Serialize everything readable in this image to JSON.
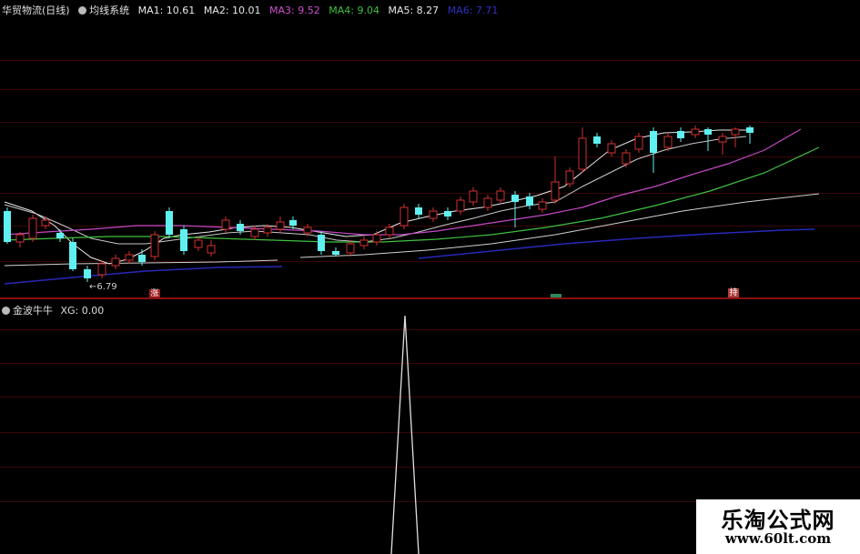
{
  "header": {
    "stock_name": "华贸物流(日线)",
    "indicator": "均线系统",
    "ma": [
      {
        "label": "MA1: 10.61",
        "color": "#e8e8e8"
      },
      {
        "label": "MA2: 10.01",
        "color": "#e8e8e8"
      },
      {
        "label": "MA3: 9.52",
        "color": "#d04cd0"
      },
      {
        "label": "MA4: 9.04",
        "color": "#40c040"
      },
      {
        "label": "MA5: 8.27",
        "color": "#e8e8e8"
      },
      {
        "label": "MA6: 7.71",
        "color": "#3030c0"
      }
    ]
  },
  "main_chart": {
    "low_label": "6.79",
    "markers": [
      {
        "text": "涨",
        "color": "#a02020"
      },
      {
        "text": "",
        "color": "#2a8a5a"
      },
      {
        "text": "持",
        "color": "#b04040"
      }
    ],
    "colors": {
      "up": "#d03030",
      "down": "#60f0f0",
      "grid": "#3a0606"
    }
  },
  "sub_chart": {
    "name": "金波牛牛",
    "value_label": "XG: 0.00",
    "line_color": "#e0e0e0"
  },
  "watermark": {
    "title": "乐淘公式网",
    "url": "www.60lt.com"
  }
}
